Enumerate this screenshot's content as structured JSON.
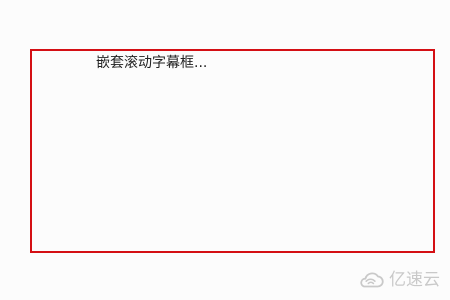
{
  "marquee": {
    "text": "嵌套滚动字幕框...",
    "border_color": "#d40f14"
  },
  "watermark": {
    "icon": "cloud-logo-icon",
    "text": "亿速云",
    "color": "#c9c9c9"
  }
}
